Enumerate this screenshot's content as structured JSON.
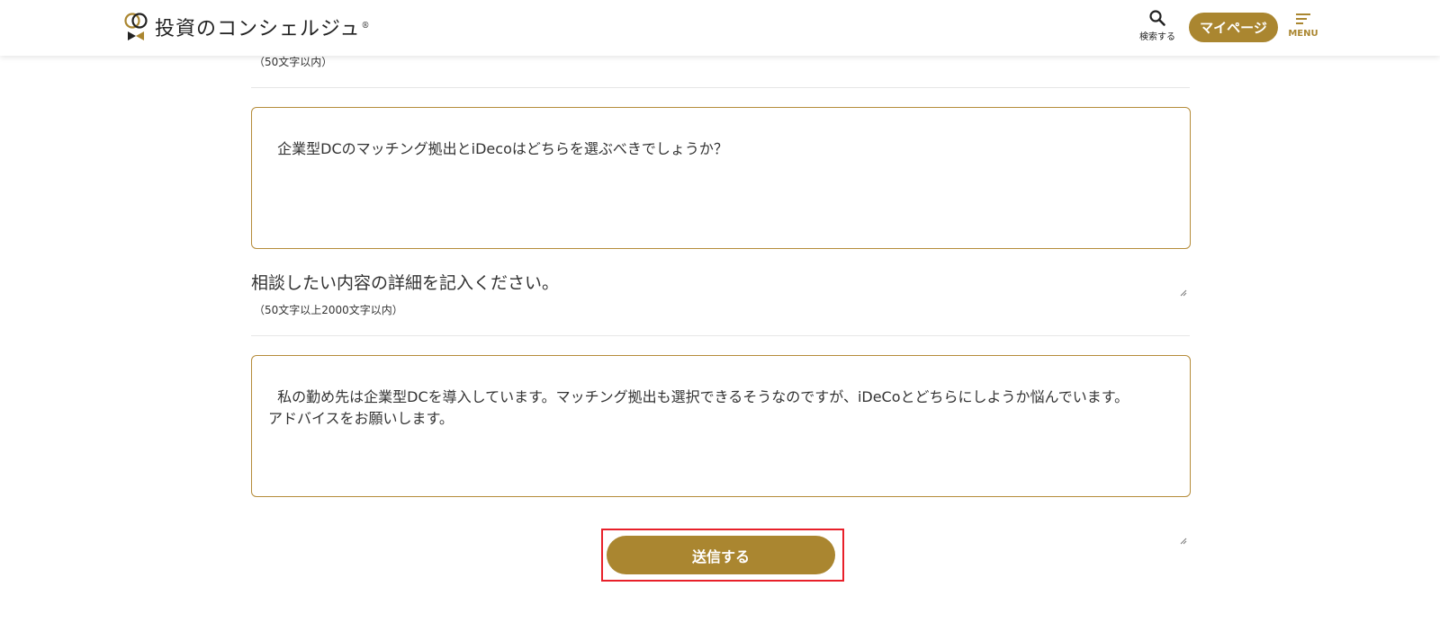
{
  "header": {
    "logo_text": "投資のコンシェルジュ",
    "logo_reg": "®",
    "search_label": "検索する",
    "mypage_label": "マイページ",
    "menu_label": "MENU"
  },
  "form": {
    "title_hint": "（50文字以内）",
    "title_value": "企業型DCのマッチング拠出とiDecoはどちらを選ぶべきでしょうか？",
    "detail_label": "相談したい内容の詳細を記入ください。",
    "detail_hint": "（50文字以上2000文字以内）",
    "detail_value": "私の勤め先は企業型DCを導入しています。マッチング拠出も選択できるそうなのですが、iDeCoとどちらにしようか悩んでいます。\nアドバイスをお願いします。",
    "submit_label": "送信する"
  },
  "colors": {
    "brand_gold": "#aa8630",
    "border_gold": "#b58c3a",
    "highlight_red": "#e8202a"
  },
  "icons": [
    "logo-mark-icon",
    "search-icon",
    "menu-icon",
    "resize-grip-icon"
  ]
}
